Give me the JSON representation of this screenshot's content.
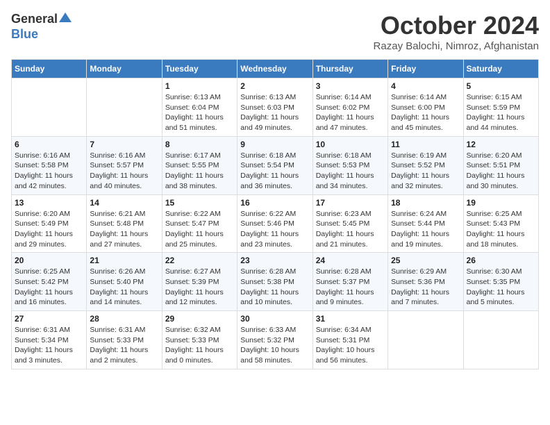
{
  "logo": {
    "general": "General",
    "blue": "Blue"
  },
  "title": "October 2024",
  "location": "Razay Balochi, Nimroz, Afghanistan",
  "weekdays": [
    "Sunday",
    "Monday",
    "Tuesday",
    "Wednesday",
    "Thursday",
    "Friday",
    "Saturday"
  ],
  "weeks": [
    [
      {
        "day": "",
        "info": ""
      },
      {
        "day": "",
        "info": ""
      },
      {
        "day": "1",
        "info": "Sunrise: 6:13 AM\nSunset: 6:04 PM\nDaylight: 11 hours and 51 minutes."
      },
      {
        "day": "2",
        "info": "Sunrise: 6:13 AM\nSunset: 6:03 PM\nDaylight: 11 hours and 49 minutes."
      },
      {
        "day": "3",
        "info": "Sunrise: 6:14 AM\nSunset: 6:02 PM\nDaylight: 11 hours and 47 minutes."
      },
      {
        "day": "4",
        "info": "Sunrise: 6:14 AM\nSunset: 6:00 PM\nDaylight: 11 hours and 45 minutes."
      },
      {
        "day": "5",
        "info": "Sunrise: 6:15 AM\nSunset: 5:59 PM\nDaylight: 11 hours and 44 minutes."
      }
    ],
    [
      {
        "day": "6",
        "info": "Sunrise: 6:16 AM\nSunset: 5:58 PM\nDaylight: 11 hours and 42 minutes."
      },
      {
        "day": "7",
        "info": "Sunrise: 6:16 AM\nSunset: 5:57 PM\nDaylight: 11 hours and 40 minutes."
      },
      {
        "day": "8",
        "info": "Sunrise: 6:17 AM\nSunset: 5:55 PM\nDaylight: 11 hours and 38 minutes."
      },
      {
        "day": "9",
        "info": "Sunrise: 6:18 AM\nSunset: 5:54 PM\nDaylight: 11 hours and 36 minutes."
      },
      {
        "day": "10",
        "info": "Sunrise: 6:18 AM\nSunset: 5:53 PM\nDaylight: 11 hours and 34 minutes."
      },
      {
        "day": "11",
        "info": "Sunrise: 6:19 AM\nSunset: 5:52 PM\nDaylight: 11 hours and 32 minutes."
      },
      {
        "day": "12",
        "info": "Sunrise: 6:20 AM\nSunset: 5:51 PM\nDaylight: 11 hours and 30 minutes."
      }
    ],
    [
      {
        "day": "13",
        "info": "Sunrise: 6:20 AM\nSunset: 5:49 PM\nDaylight: 11 hours and 29 minutes."
      },
      {
        "day": "14",
        "info": "Sunrise: 6:21 AM\nSunset: 5:48 PM\nDaylight: 11 hours and 27 minutes."
      },
      {
        "day": "15",
        "info": "Sunrise: 6:22 AM\nSunset: 5:47 PM\nDaylight: 11 hours and 25 minutes."
      },
      {
        "day": "16",
        "info": "Sunrise: 6:22 AM\nSunset: 5:46 PM\nDaylight: 11 hours and 23 minutes."
      },
      {
        "day": "17",
        "info": "Sunrise: 6:23 AM\nSunset: 5:45 PM\nDaylight: 11 hours and 21 minutes."
      },
      {
        "day": "18",
        "info": "Sunrise: 6:24 AM\nSunset: 5:44 PM\nDaylight: 11 hours and 19 minutes."
      },
      {
        "day": "19",
        "info": "Sunrise: 6:25 AM\nSunset: 5:43 PM\nDaylight: 11 hours and 18 minutes."
      }
    ],
    [
      {
        "day": "20",
        "info": "Sunrise: 6:25 AM\nSunset: 5:42 PM\nDaylight: 11 hours and 16 minutes."
      },
      {
        "day": "21",
        "info": "Sunrise: 6:26 AM\nSunset: 5:40 PM\nDaylight: 11 hours and 14 minutes."
      },
      {
        "day": "22",
        "info": "Sunrise: 6:27 AM\nSunset: 5:39 PM\nDaylight: 11 hours and 12 minutes."
      },
      {
        "day": "23",
        "info": "Sunrise: 6:28 AM\nSunset: 5:38 PM\nDaylight: 11 hours and 10 minutes."
      },
      {
        "day": "24",
        "info": "Sunrise: 6:28 AM\nSunset: 5:37 PM\nDaylight: 11 hours and 9 minutes."
      },
      {
        "day": "25",
        "info": "Sunrise: 6:29 AM\nSunset: 5:36 PM\nDaylight: 11 hours and 7 minutes."
      },
      {
        "day": "26",
        "info": "Sunrise: 6:30 AM\nSunset: 5:35 PM\nDaylight: 11 hours and 5 minutes."
      }
    ],
    [
      {
        "day": "27",
        "info": "Sunrise: 6:31 AM\nSunset: 5:34 PM\nDaylight: 11 hours and 3 minutes."
      },
      {
        "day": "28",
        "info": "Sunrise: 6:31 AM\nSunset: 5:33 PM\nDaylight: 11 hours and 2 minutes."
      },
      {
        "day": "29",
        "info": "Sunrise: 6:32 AM\nSunset: 5:33 PM\nDaylight: 11 hours and 0 minutes."
      },
      {
        "day": "30",
        "info": "Sunrise: 6:33 AM\nSunset: 5:32 PM\nDaylight: 10 hours and 58 minutes."
      },
      {
        "day": "31",
        "info": "Sunrise: 6:34 AM\nSunset: 5:31 PM\nDaylight: 10 hours and 56 minutes."
      },
      {
        "day": "",
        "info": ""
      },
      {
        "day": "",
        "info": ""
      }
    ]
  ]
}
